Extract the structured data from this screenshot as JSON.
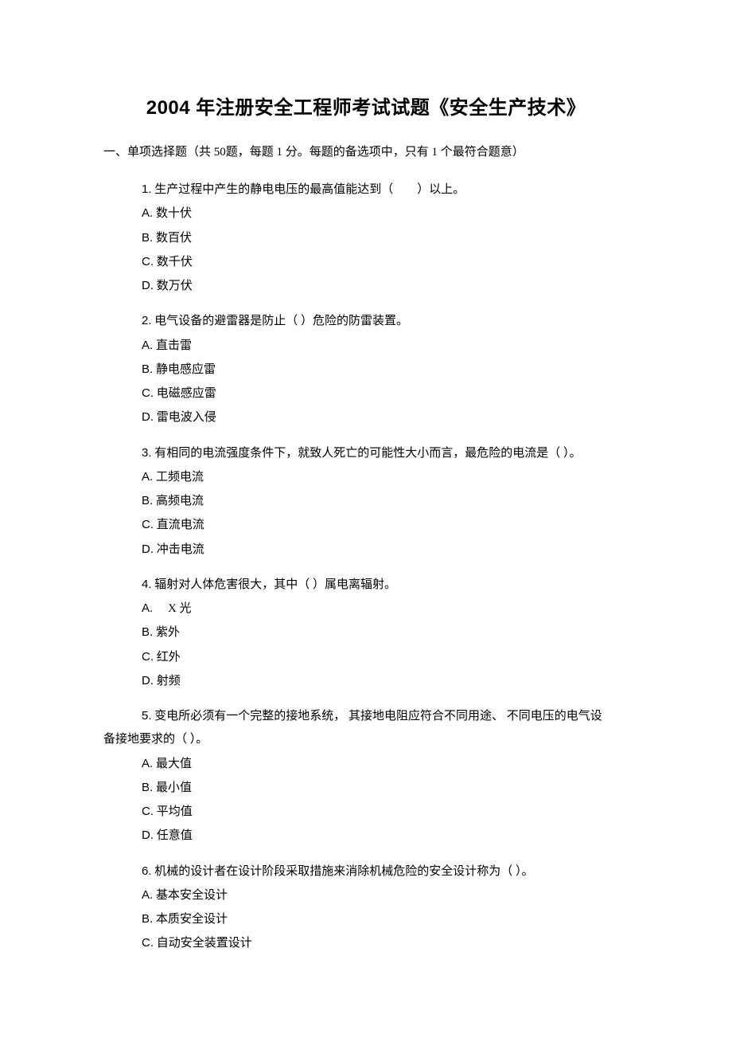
{
  "title": "2004 年注册安全工程师考试试题《安全生产技术》",
  "section1_heading": "一、单项选择题（共 50题，每题 1 分。每题的备选项中，只有 1 个最符合题意）",
  "section1_count": "50",
  "section1_points": "1",
  "section1_match": "1",
  "q1": {
    "num": "1.",
    "text": "生产过程中产生的静电电压的最高值能达到（　　）以上。",
    "a": "数十伏",
    "b": "数百伏",
    "c": "数千伏",
    "d": "数万伏"
  },
  "q2": {
    "num": "2.",
    "text": "电气设备的避雷器是防止（ ）危险的防雷装置。",
    "a": "直击雷",
    "b": "静电感应雷",
    "c": "电磁感应雷",
    "d": "雷电波入侵"
  },
  "q3": {
    "num": "3.",
    "text": "有相同的电流强度条件下，就致人死亡的可能性大小而言，最危险的电流是（ ）。",
    "a": "工频电流",
    "b": "高频电流",
    "c": "直流电流",
    "d": "冲击电流"
  },
  "q4": {
    "num": "4.",
    "text": "辐射对人体危害很大，其中（ ）属电离辐射。",
    "a": "　X 光",
    "b": "紫外",
    "c": "红外",
    "d": "射频"
  },
  "q5": {
    "num": "5.",
    "text1": "变电所必须有一个完整的接地系统， 其接地电阻应符合不同用途、 不同电压的电气设",
    "text2": "备接地要求的（ ）。",
    "a": "最大值",
    "b": "最小值",
    "c": "平均值",
    "d": "任意值"
  },
  "q6": {
    "num": "6.",
    "text": "机械的设计者在设计阶段采取措施来消除机械危险的安全设计称为（ ）。",
    "a": "基本安全设计",
    "b": "本质安全设计",
    "c": "自动安全装置设计"
  },
  "labels": {
    "A": "A.",
    "B": "B.",
    "C": "C.",
    "D": "D."
  }
}
